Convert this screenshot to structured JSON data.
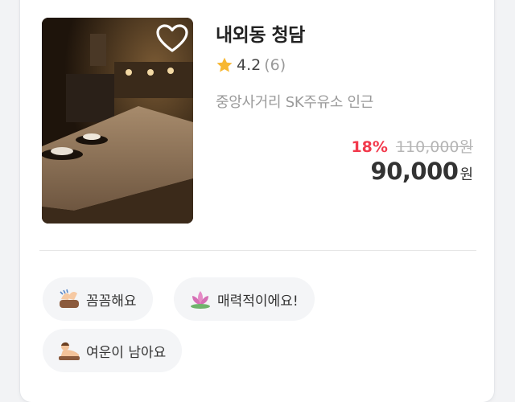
{
  "listing": {
    "title": "내외동 청담",
    "rating": "4.2",
    "review_count": "(6)",
    "address": "중앙사거리 SK주유소 인근",
    "discount": "18%",
    "original_price": "110,000원",
    "price": "90,000",
    "currency": "원",
    "favorite": false
  },
  "tags": [
    {
      "label": "꼼꼼해요",
      "icon": "massage-hands-icon"
    },
    {
      "label": "매력적이에요!",
      "icon": "lotus-icon"
    },
    {
      "label": "여운이 남아요",
      "icon": "relaxing-person-icon"
    }
  ],
  "colors": {
    "discount": "#f2394c",
    "star": "#f7b731",
    "tag_bg": "#f4f5f7"
  }
}
